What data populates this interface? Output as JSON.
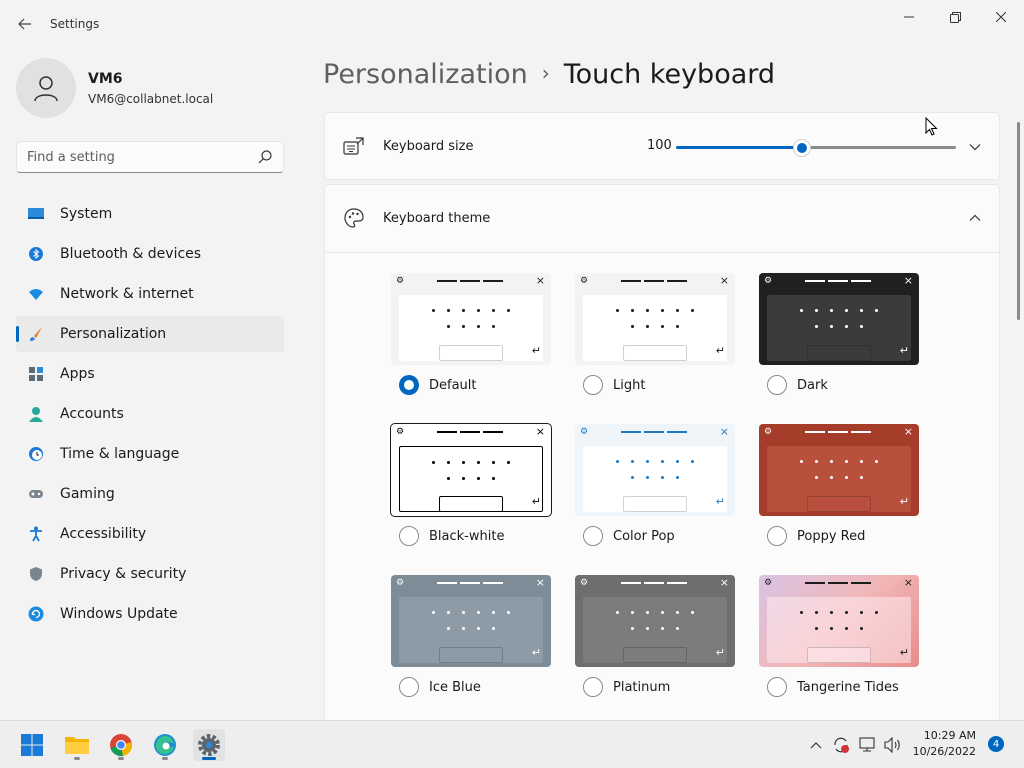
{
  "window": {
    "title": "Settings",
    "back_icon": "arrow-left-icon",
    "minimize_icon": "minimize-icon",
    "restore_icon": "restore-icon",
    "close_icon": "close-icon"
  },
  "user": {
    "name": "VM6",
    "email": "VM6@collabnet.local",
    "avatar_icon": "person-icon"
  },
  "search": {
    "placeholder": "Find a setting",
    "icon": "search-icon"
  },
  "sidebar": {
    "items": [
      {
        "label": "System",
        "icon": "monitor-icon",
        "active": false
      },
      {
        "label": "Bluetooth & devices",
        "icon": "bluetooth-icon",
        "active": false
      },
      {
        "label": "Network & internet",
        "icon": "wifi-icon",
        "active": false
      },
      {
        "label": "Personalization",
        "icon": "brush-icon",
        "active": true
      },
      {
        "label": "Apps",
        "icon": "apps-icon",
        "active": false
      },
      {
        "label": "Accounts",
        "icon": "person-icon",
        "active": false
      },
      {
        "label": "Time & language",
        "icon": "clock-globe-icon",
        "active": false
      },
      {
        "label": "Gaming",
        "icon": "gamepad-icon",
        "active": false
      },
      {
        "label": "Accessibility",
        "icon": "accessibility-icon",
        "active": false
      },
      {
        "label": "Privacy & security",
        "icon": "shield-icon",
        "active": false
      },
      {
        "label": "Windows Update",
        "icon": "refresh-icon",
        "active": false
      }
    ]
  },
  "breadcrumb": {
    "parent": "Personalization",
    "separator": "›",
    "current": "Touch keyboard"
  },
  "keyboard_size": {
    "label": "Keyboard size",
    "value": "100",
    "slider_fraction": 0.45,
    "icon": "keyboard-resize-icon",
    "expand_icon": "chevron-down-icon"
  },
  "keyboard_theme": {
    "label": "Keyboard theme",
    "icon": "palette-icon",
    "collapse_icon": "chevron-up-icon",
    "themes": [
      {
        "name": "Default",
        "selected": true,
        "bg": "#f3f3f3",
        "panel": "#ffffff",
        "ink": "#1b1b1b",
        "space": "#ffffff",
        "outlined": false
      },
      {
        "name": "Light",
        "selected": false,
        "bg": "#f3f3f3",
        "panel": "#ffffff",
        "ink": "#1b1b1b",
        "space": "#ffffff",
        "outlined": false
      },
      {
        "name": "Dark",
        "selected": false,
        "bg": "#202020",
        "panel": "#3b3b3b",
        "ink": "#ffffff",
        "space": "#3b3b3b",
        "outlined": false
      },
      {
        "name": "Black-white",
        "selected": false,
        "bg": "#ffffff",
        "panel": "#ffffff",
        "ink": "#000000",
        "space": "#ffffff",
        "outlined": true
      },
      {
        "name": "Color Pop",
        "selected": false,
        "bg": "#f0f5f9",
        "panel": "#ffffff",
        "ink": "#1e7bc2",
        "space": "#ffffff",
        "outlined": false
      },
      {
        "name": "Poppy Red",
        "selected": false,
        "bg": "#a63c2a",
        "panel": "#b9503e",
        "ink": "#ffffff",
        "space": "#b9503e",
        "outlined": false
      },
      {
        "name": "Ice Blue",
        "selected": false,
        "bg": "#7d8c96",
        "panel": "#8c9ba5",
        "ink": "#ffffff",
        "space": "#8c9ba5",
        "outlined": false
      },
      {
        "name": "Platinum",
        "selected": false,
        "bg": "#6e6e6e",
        "panel": "#7c7c7c",
        "ink": "#ffffff",
        "space": "#7c7c7c",
        "outlined": false
      },
      {
        "name": "Tangerine Tides",
        "selected": false,
        "bg": "linear-gradient(135deg,#d9c4e6,#f1b7b7,#e88c8c)",
        "panel": "rgba(255,235,240,0.55)",
        "ink": "#1b1b1b",
        "space": "rgba(255,235,240,0.55)",
        "outlined": false
      }
    ]
  },
  "taskbar": {
    "apps": [
      {
        "name": "start",
        "icon": "windows-start-icon"
      },
      {
        "name": "file-explorer",
        "icon": "folder-icon"
      },
      {
        "name": "chrome",
        "icon": "chrome-icon"
      },
      {
        "name": "edge",
        "icon": "edge-icon"
      },
      {
        "name": "settings",
        "icon": "gear-icon"
      }
    ],
    "tray_icons": [
      "chevron-up-icon",
      "sync-error-icon",
      "network-icon",
      "speaker-icon"
    ],
    "time": "10:29 AM",
    "date": "10/26/2022",
    "notification_count": "4"
  },
  "colors": {
    "accent": "#0067c0",
    "background": "#f3f3f3",
    "card": "#fbfbfb"
  }
}
